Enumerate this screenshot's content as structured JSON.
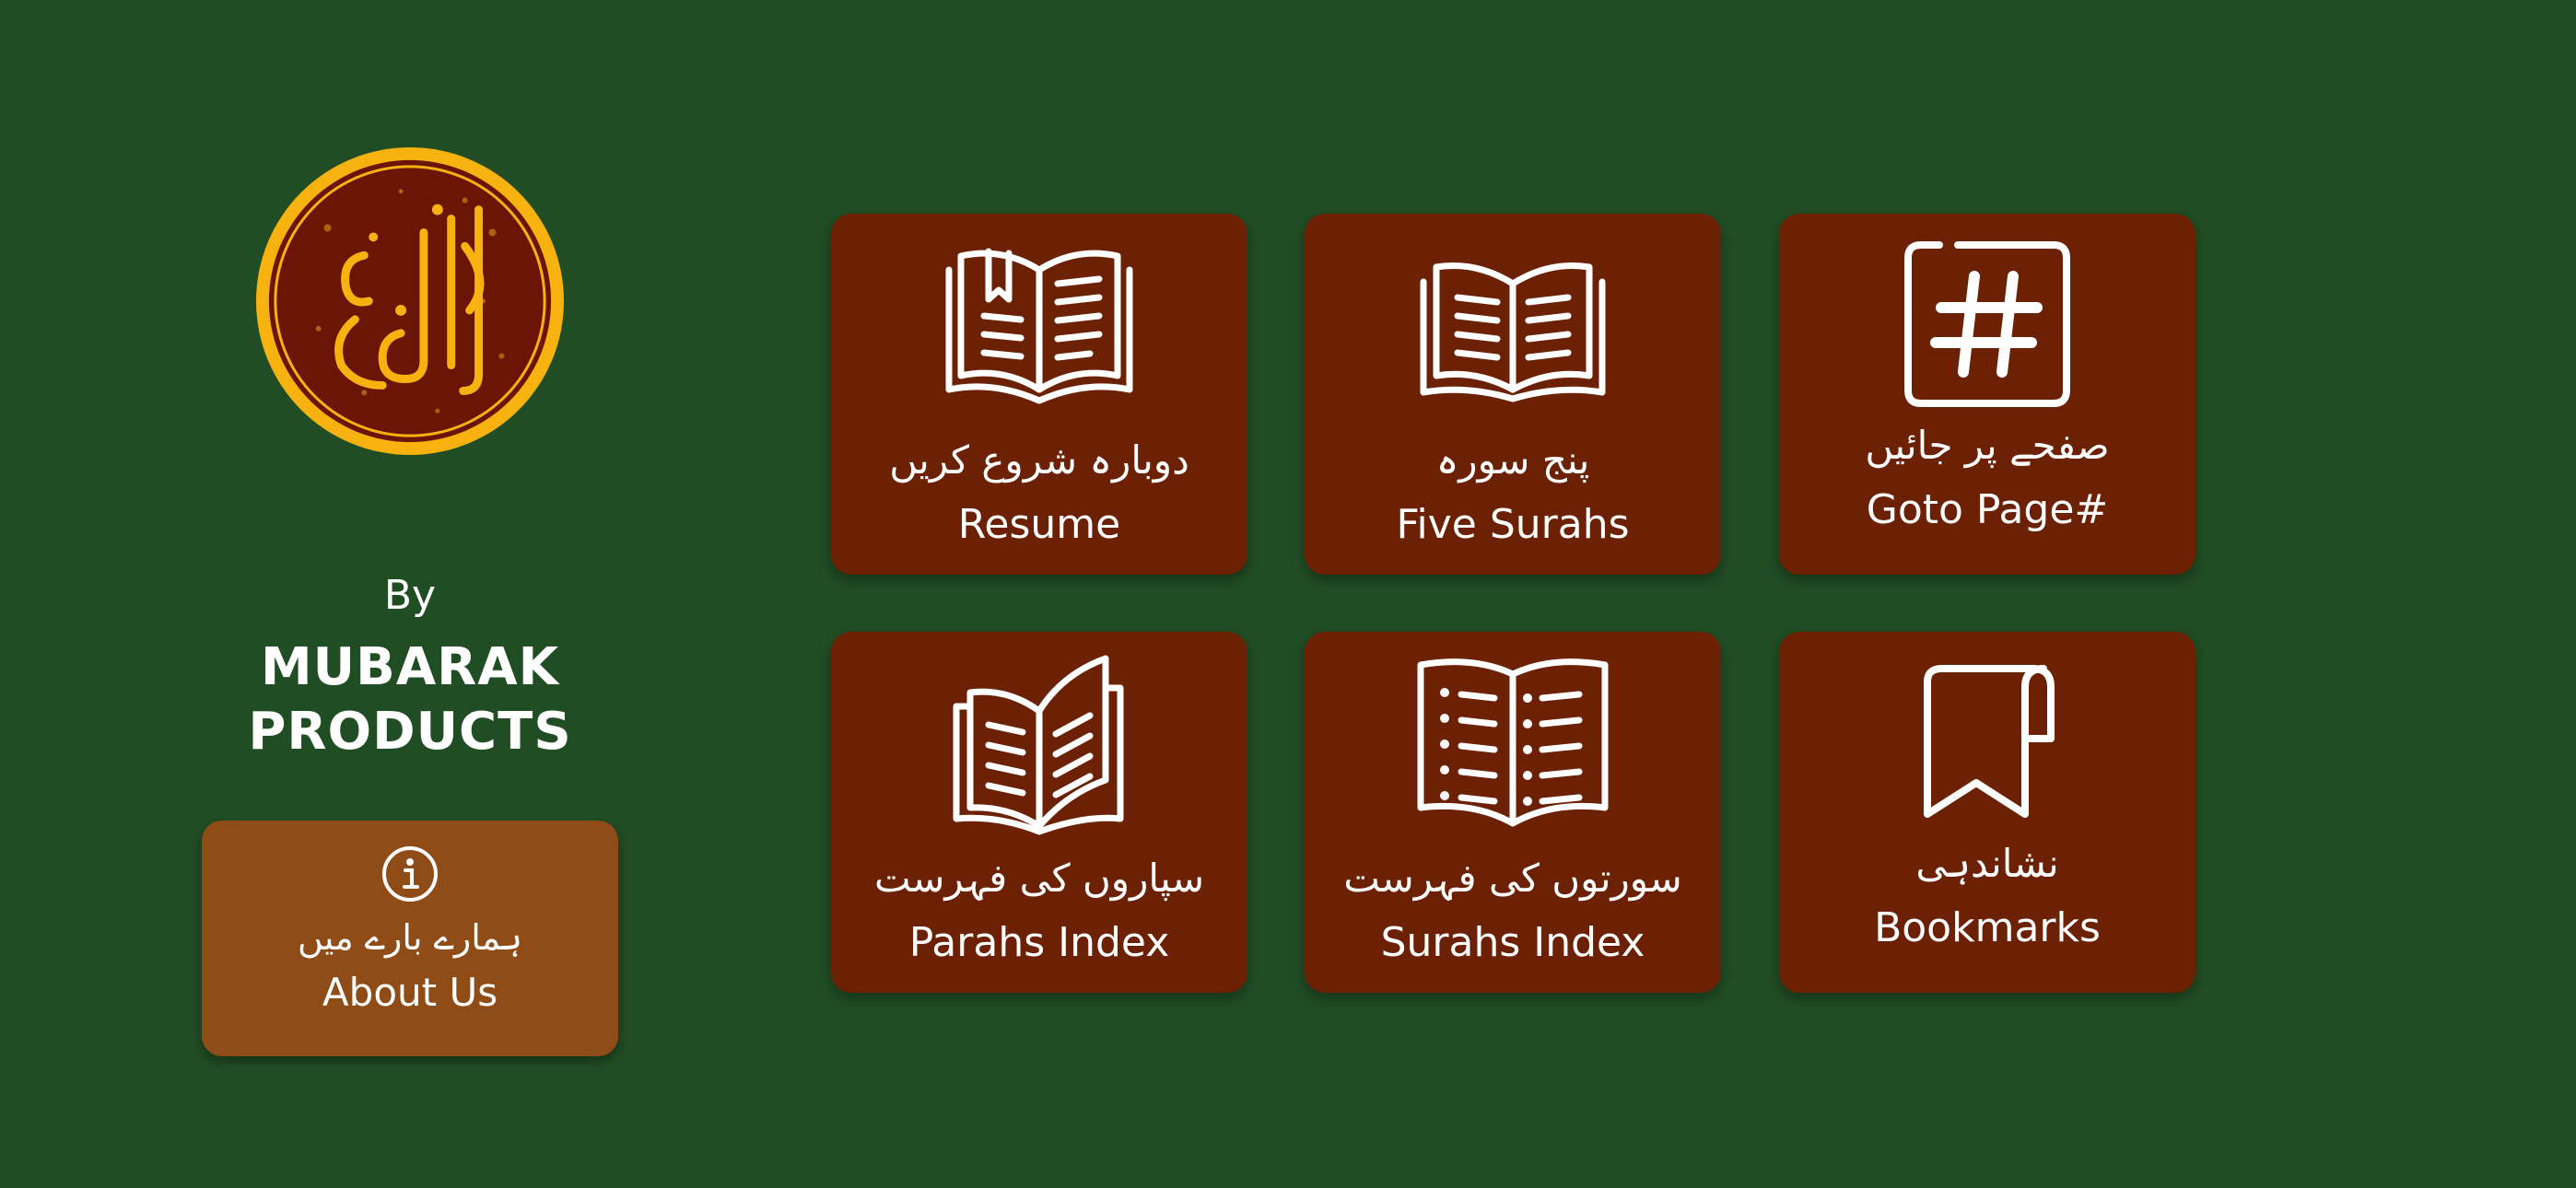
{
  "sidebar": {
    "by_label": "By",
    "company_line1": "MUBARAK",
    "company_line2": "PRODUCTS",
    "logo_icon": "quran-kareem-calligraphy-seal",
    "logo_text": "القرآن الكريم",
    "about": {
      "urdu": "ہمارے بارے میں",
      "english": "About Us",
      "icon": "info-icon"
    }
  },
  "tiles": [
    {
      "id": "resume",
      "urdu": "دوبارہ شروع کریں",
      "english": "Resume",
      "icon": "open-book-bookmark-icon"
    },
    {
      "id": "five-surahs",
      "urdu": "پنج سورہ",
      "english": "Five Surahs",
      "icon": "open-book-icon"
    },
    {
      "id": "goto-page",
      "urdu": "صفحے پر جائیں",
      "english": "Goto Page#",
      "icon": "hash-icon"
    },
    {
      "id": "parahs-index",
      "urdu": "سپاروں کی فہرست",
      "english": "Parahs Index",
      "icon": "open-book-list-icon"
    },
    {
      "id": "surahs-index",
      "urdu": "سورتوں کی فہرست",
      "english": "Surahs Index",
      "icon": "open-book-bullets-icon"
    },
    {
      "id": "bookmarks",
      "urdu": "نشاندہی",
      "english": "Bookmarks",
      "icon": "bookmark-icon"
    }
  ],
  "colors": {
    "background": "#214d24",
    "tile": "#6c2104",
    "about_button": "#8f4c16",
    "logo_gold": "#f7b20f",
    "logo_maroon": "#6a1506"
  }
}
